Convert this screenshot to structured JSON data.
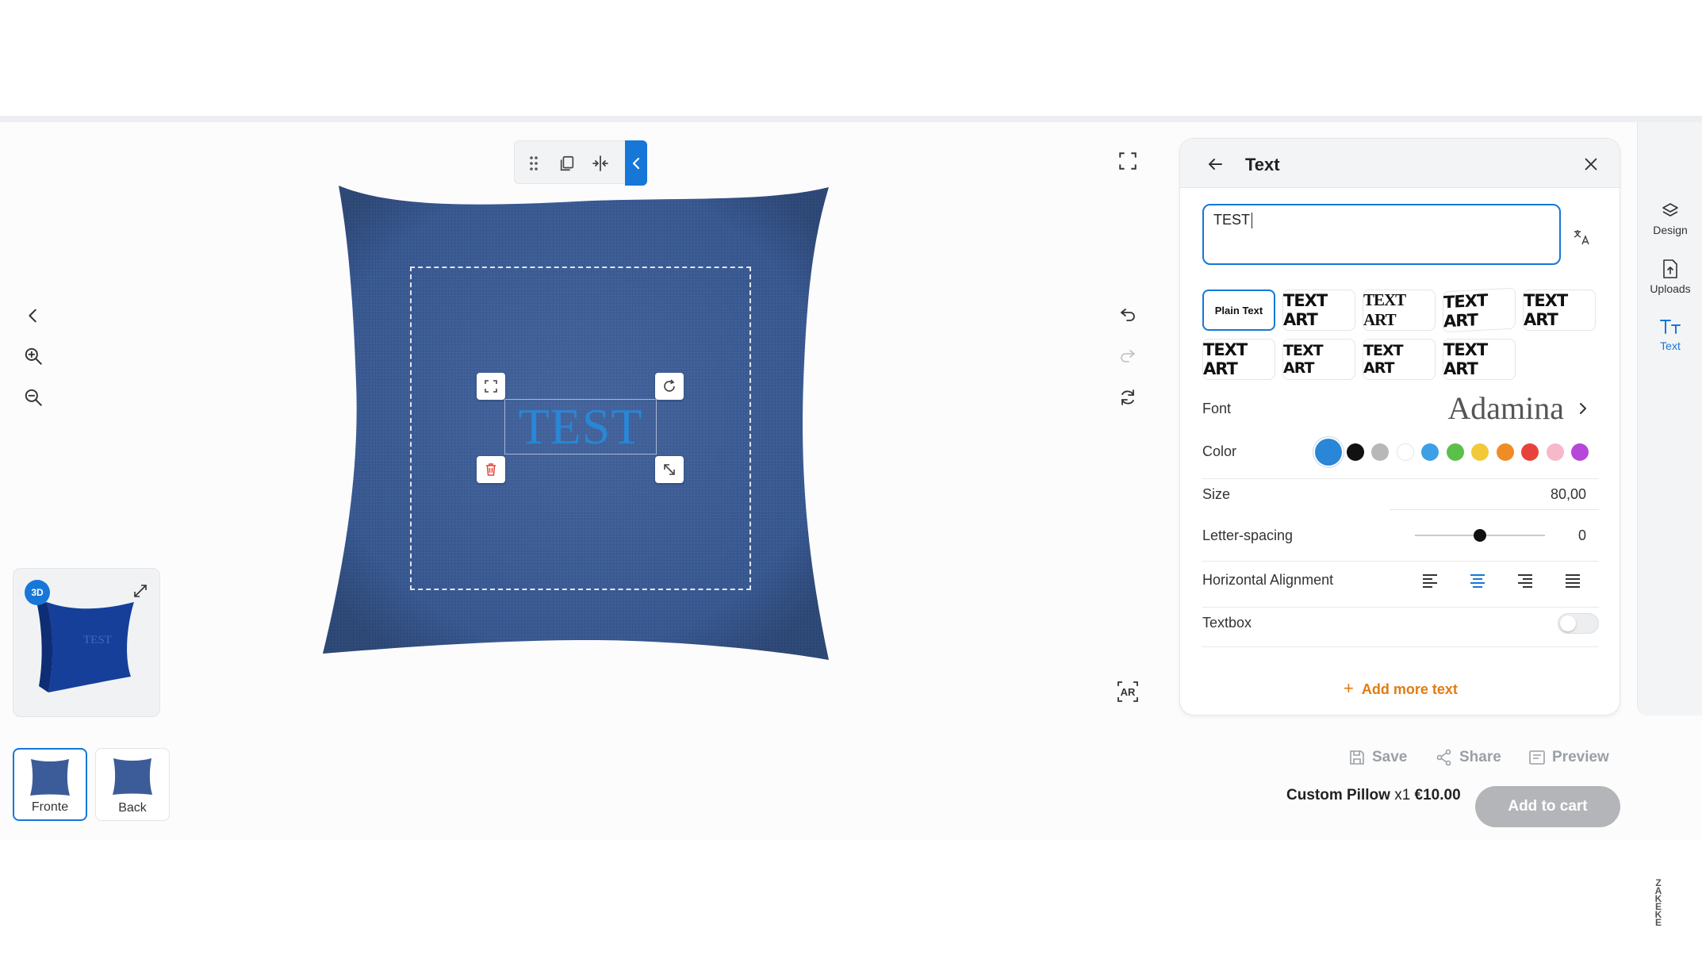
{
  "canvas": {
    "product_text": "TEST",
    "text_color": "#2a86d6",
    "pillow_color": "#3b5c98"
  },
  "views": [
    {
      "label": "Fronte",
      "active": true
    },
    {
      "label": "Back",
      "active": false
    }
  ],
  "thumbnail_3d": {
    "badge": "3D",
    "preview_text": "TEST"
  },
  "ar_label": "AR",
  "panel": {
    "title": "Text",
    "textarea_value": "TEST",
    "text_styles": [
      "Plain Text",
      "TEXT ART",
      "TEXT ART",
      "TEXT ART",
      "TEXT ART",
      "TEXT ART",
      "TEXT ART",
      "TEXT ART",
      "TEXT ART"
    ],
    "font_label": "Font",
    "font_value": "Adamina",
    "color_label": "Color",
    "colors": [
      "#2a86d6",
      "#111111",
      "#b8b8b8",
      "#ffffff",
      "#3da0e6",
      "#5cbf4a",
      "#f3c93a",
      "#ef8c26",
      "#e8433a",
      "#f5b9c9",
      "#b747d8"
    ],
    "size_label": "Size",
    "size_value": "80,00",
    "letter_spacing_label": "Letter-spacing",
    "letter_spacing_value": "0",
    "letter_spacing_level": 0.5,
    "alignment_label": "Horizontal Alignment",
    "textbox_label": "Textbox",
    "textbox_on": false,
    "add_more_label": "Add more text"
  },
  "rail": [
    {
      "label": "Design",
      "icon": "layers-icon"
    },
    {
      "label": "Uploads",
      "icon": "upload-icon"
    },
    {
      "label": "Text",
      "icon": "text-icon"
    }
  ],
  "actions": {
    "save": "Save",
    "share": "Share",
    "preview": "Preview"
  },
  "cart": {
    "product": "Custom Pillow",
    "qty": "x1",
    "price": "€10.00",
    "add_label": "Add to cart"
  },
  "brand_mark": "ZAKEKE"
}
